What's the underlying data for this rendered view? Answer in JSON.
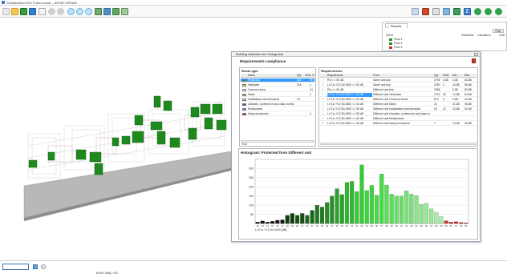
{
  "window": {
    "title": "SONarchitect ISO Profes.sonar – AFSEP 2/RN/M",
    "colors": {
      "accent": "#3a7fc8",
      "green": "#1e8a1e",
      "selection": "#3399ff"
    }
  },
  "toolbar": {
    "icons": [
      "new-icon",
      "open-icon",
      "save-icon",
      "save-as-icon",
      "print-icon",
      "undo-icon",
      "redo-icon",
      "zoom-in-icon",
      "zoom-out-icon",
      "zoom-fit-icon",
      "view-3d-icon",
      "view-front-icon",
      "view-side-icon",
      "view-top-icon"
    ],
    "right_icons": [
      "chart-icon",
      "report-icon",
      "measure-icon",
      "layers-icon",
      "pin-icon",
      "sigma-icon",
      "refresh-icon",
      "rotate-left-icon",
      "rotate-right-icon"
    ]
  },
  "results_panel": {
    "tab_label": "Results",
    "filter_label": "Filter",
    "headers": {
      "client": "Client",
      "parameter": "Parameter",
      "calculation": "Calculation",
      "limit": "Limit"
    },
    "rows": [
      {
        "label": "Floor 1",
        "color": "#2d8f2d"
      },
      {
        "label": "Floor 1",
        "color": "#2d8f2d"
      },
      {
        "label": "Floor 1",
        "color": "#c83030"
      }
    ]
  },
  "dialog": {
    "title": "Building statistics and histograms",
    "compliance_title": "Requirements compliance",
    "room_type_panel": {
      "label": "Room type",
      "headers": [
        "Name",
        "Qty",
        "%Ok",
        "%"
      ],
      "rows": [
        {
          "name": "Protected",
          "qty": "862",
          "pct": "46",
          "color": "#2d8f2d",
          "selected": true
        },
        {
          "name": "Habitable",
          "qty": "316",
          "pct": "1",
          "color": "#f0e040",
          "selected": false
        },
        {
          "name": "Common Area",
          "qty": "",
          "pct": "14",
          "color": "#ffffff",
          "selected": false
        },
        {
          "name": "Stairs",
          "qty": "",
          "pct": "1",
          "color": "#ff9933",
          "selected": false
        },
        {
          "name": "Installations and elevators",
          "qty": "10",
          "pct": "",
          "color": "#d9d9d9",
          "selected": false
        },
        {
          "name": "Libraries, conference and class rooms",
          "qty": "",
          "pct": "",
          "color": "#663399",
          "selected": false
        },
        {
          "name": "Restaurants",
          "qty": "",
          "pct": "",
          "color": "#cc66cc",
          "selected": false
        },
        {
          "name": "Noisy enclosures",
          "qty": "",
          "pct": "4",
          "color": "#cc2222",
          "selected": false
        }
      ],
      "footer": "Exit"
    },
    "requirements_panel": {
      "label": "Requirements",
      "headers": [
        "Requirement",
        "From",
        "Qty",
        "%Ok",
        "Min",
        "Max"
      ],
      "rows": [
        {
          "req": "R'w >= 50 dB",
          "from": "Same unit Any",
          "qty": "2795",
          "ok": "0-88",
          "min": "0-88",
          "max": "64-88",
          "selected": false
        },
        {
          "req": "L'nT,w +C2,50-2500 <= 50 dB",
          "from": "Same unit Any",
          "qty": "2250",
          "ok": "2",
          "min": "16-88",
          "max": "55-88",
          "selected": false
        },
        {
          "req": "R'w >= 50 dB",
          "from": "Different unit Any",
          "qty": "3366",
          "ok": "",
          "min": "0-88",
          "max": "82-88",
          "selected": false
        },
        {
          "req": "L'nT,w +C2,50-2500 <= 50 dB",
          "from": "Different unit Otherwise",
          "qty": "2722",
          "ok": "28",
          "min": "12-88",
          "max": "54-88",
          "selected": true
        },
        {
          "req": "L'nT,w +C2,50-2500 <= 50 dB",
          "from": "Different unit Common Areas",
          "qty": "873",
          "ok": "5",
          "min": "0-88",
          "max": "34-88",
          "selected": false
        },
        {
          "req": "L'nT,w +C2,50-2500 <= 40 dB",
          "from": "Different unit Stairs",
          "qty": "24",
          "ok": "",
          "min": "21-88",
          "max": "35-88",
          "selected": false
        },
        {
          "req": "L'nT,w +C2,50-2500 <= 50 dB",
          "from": "Different unit Installations and elevators",
          "qty": "93",
          "ok": "12",
          "min": "23-88",
          "max": "52-88",
          "selected": false
        },
        {
          "req": "L'nT,w +C2,50-2500 <= 55 dB",
          "from": "Different unit Libraries, conference and class ro",
          "qty": "",
          "ok": "",
          "min": "",
          "max": "",
          "selected": false
        },
        {
          "req": "L'nT,w +C2,50-2500 <= 60 dB",
          "from": "Different unit Restaurants",
          "qty": "",
          "ok": "",
          "min": "",
          "max": "",
          "selected": false
        },
        {
          "req": "L'nT,w +C2,50-2500 <= 45 dB",
          "from": "Different unit Noisy enclosures",
          "qty": "7",
          "ok": "",
          "min": "13-88",
          "max": "45-88",
          "selected": false
        }
      ]
    },
    "histogram_title": "Histogram: Protected from Different unit"
  },
  "chart_data": {
    "type": "bar",
    "title": "Histogram: Protected from Different unit",
    "xlabel": "L'nT,w +C2,50-2500 [dB]",
    "ylabel": "",
    "ylim": [
      0,
      350
    ],
    "yticks": [
      50,
      100,
      150,
      200,
      250,
      300
    ],
    "categories": [
      "12",
      "13",
      "14",
      "15",
      "16",
      "17",
      "18",
      "19",
      "20",
      "21",
      "22",
      "23",
      "24",
      "25",
      "26",
      "27",
      "28",
      "29",
      "30",
      "31",
      "32",
      "33",
      "34",
      "35",
      "36",
      "37",
      "38",
      "39",
      "40",
      "41",
      "42",
      "43",
      "44",
      "45",
      "46",
      "47",
      "48",
      "49",
      "50",
      "51",
      "52",
      "53",
      "54"
    ],
    "values": [
      8,
      14,
      8,
      12,
      18,
      20,
      45,
      55,
      45,
      55,
      45,
      72,
      100,
      90,
      115,
      150,
      190,
      158,
      225,
      230,
      175,
      320,
      180,
      208,
      155,
      270,
      210,
      160,
      150,
      150,
      178,
      160,
      152,
      105,
      110,
      80,
      62,
      38,
      15,
      8,
      10,
      6,
      4
    ],
    "colors": [
      "#111111",
      "#111111",
      "#111111",
      "#111111",
      "#111111",
      "#111111",
      "#0f3d0f",
      "#0f3d0f",
      "#145214",
      "#145214",
      "#1a661a",
      "#1a661a",
      "#1f7a1f",
      "#1f7a1f",
      "#248f24",
      "#248f24",
      "#29a329",
      "#29a329",
      "#2eb82e",
      "#2eb82e",
      "#33cc33",
      "#33cc33",
      "#3ad63a",
      "#3ad63a",
      "#44dd44",
      "#44dd44",
      "#55e055",
      "#55e055",
      "#66e066",
      "#66e066",
      "#77e377",
      "#77e377",
      "#88e688",
      "#88e688",
      "#99e999",
      "#99e999",
      "#aaeeaa",
      "#aaeeaa",
      "#cc3333",
      "#cc2222",
      "#cc2222",
      "#bb1111",
      "#bb1111"
    ],
    "grid": true
  },
  "status": {
    "zoom_value": "",
    "info": "100%  3MQ +02"
  }
}
